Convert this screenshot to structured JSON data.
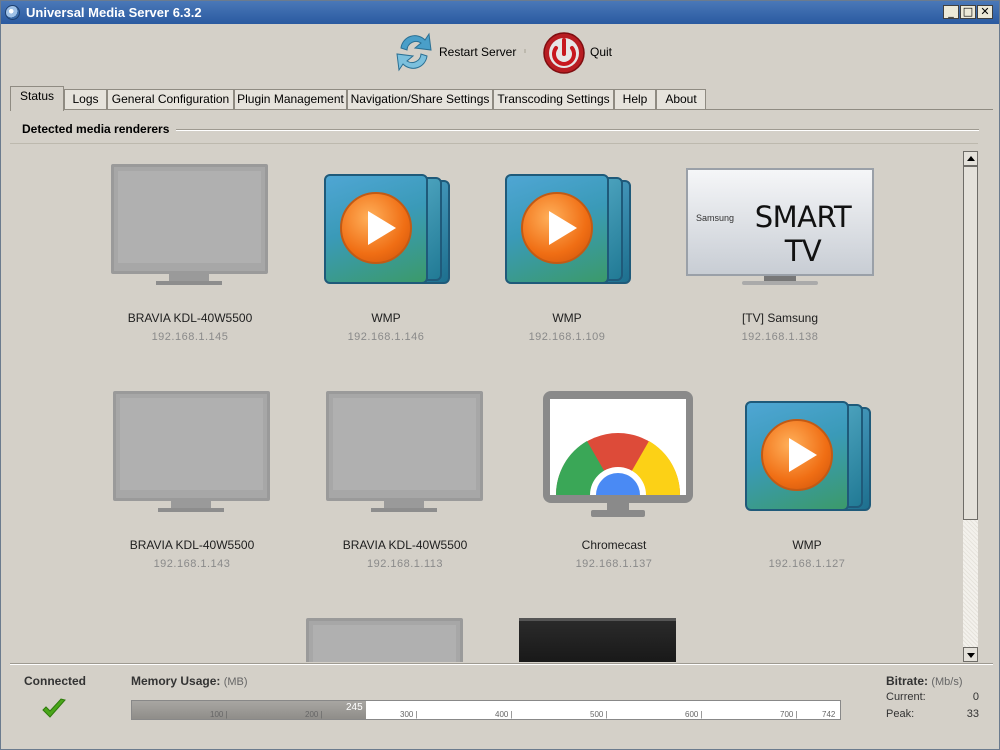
{
  "window": {
    "title": "Universal Media Server 6.3.2",
    "controls": {
      "minimize": "_",
      "maximize": "□",
      "close": "✕"
    }
  },
  "toolbar": {
    "restart_label": "Restart Server",
    "quit_label": "Quit"
  },
  "tabs": [
    {
      "label": "Status",
      "active": true
    },
    {
      "label": "Logs"
    },
    {
      "label": "General Configuration"
    },
    {
      "label": "Plugin Management"
    },
    {
      "label": "Navigation/Share Settings"
    },
    {
      "label": "Transcoding Settings"
    },
    {
      "label": "Help"
    },
    {
      "label": "About"
    }
  ],
  "section": {
    "title": "Detected media renderers"
  },
  "renderers": [
    {
      "name": "BRAVIA KDL-40W5500",
      "ip": "192.168.1.145",
      "icon": "tv-icon"
    },
    {
      "name": "WMP",
      "ip": "192.168.1.146",
      "icon": "wmp-icon"
    },
    {
      "name": "WMP",
      "ip": "192.168.1.109",
      "icon": "wmp-icon"
    },
    {
      "name": "[TV] Samsung",
      "ip": "192.168.1.138",
      "icon": "samsung-smart-tv-icon"
    },
    {
      "name": "BRAVIA KDL-40W5500",
      "ip": "192.168.1.143",
      "icon": "tv-icon"
    },
    {
      "name": "BRAVIA KDL-40W5500",
      "ip": "192.168.1.113",
      "icon": "tv-icon"
    },
    {
      "name": "Chromecast",
      "ip": "192.168.1.137",
      "icon": "chromecast-icon"
    },
    {
      "name": "WMP",
      "ip": "192.168.1.127",
      "icon": "wmp-icon"
    }
  ],
  "samsung_logo": {
    "brand": "Samsung",
    "text": "SMART TV"
  },
  "status": {
    "connected_label": "Connected",
    "memory": {
      "label": "Memory Usage:",
      "unit": "(MB)",
      "used": 245,
      "max": 742,
      "ticks": [
        "100 |",
        "200 |",
        "300 |",
        "400 |",
        "500 |",
        "600 |",
        "700 |",
        "742"
      ]
    },
    "bitrate": {
      "label": "Bitrate:",
      "unit": "(Mb/s)",
      "current_label": "Current:",
      "current_value": "0",
      "peak_label": "Peak:",
      "peak_value": "33"
    }
  },
  "colors": {
    "titlebar": "#3566ac",
    "background": "#d4d0c8",
    "memory_fill": "#9b9995",
    "check": "#4aa61a",
    "quit_red": "#c8181e"
  }
}
